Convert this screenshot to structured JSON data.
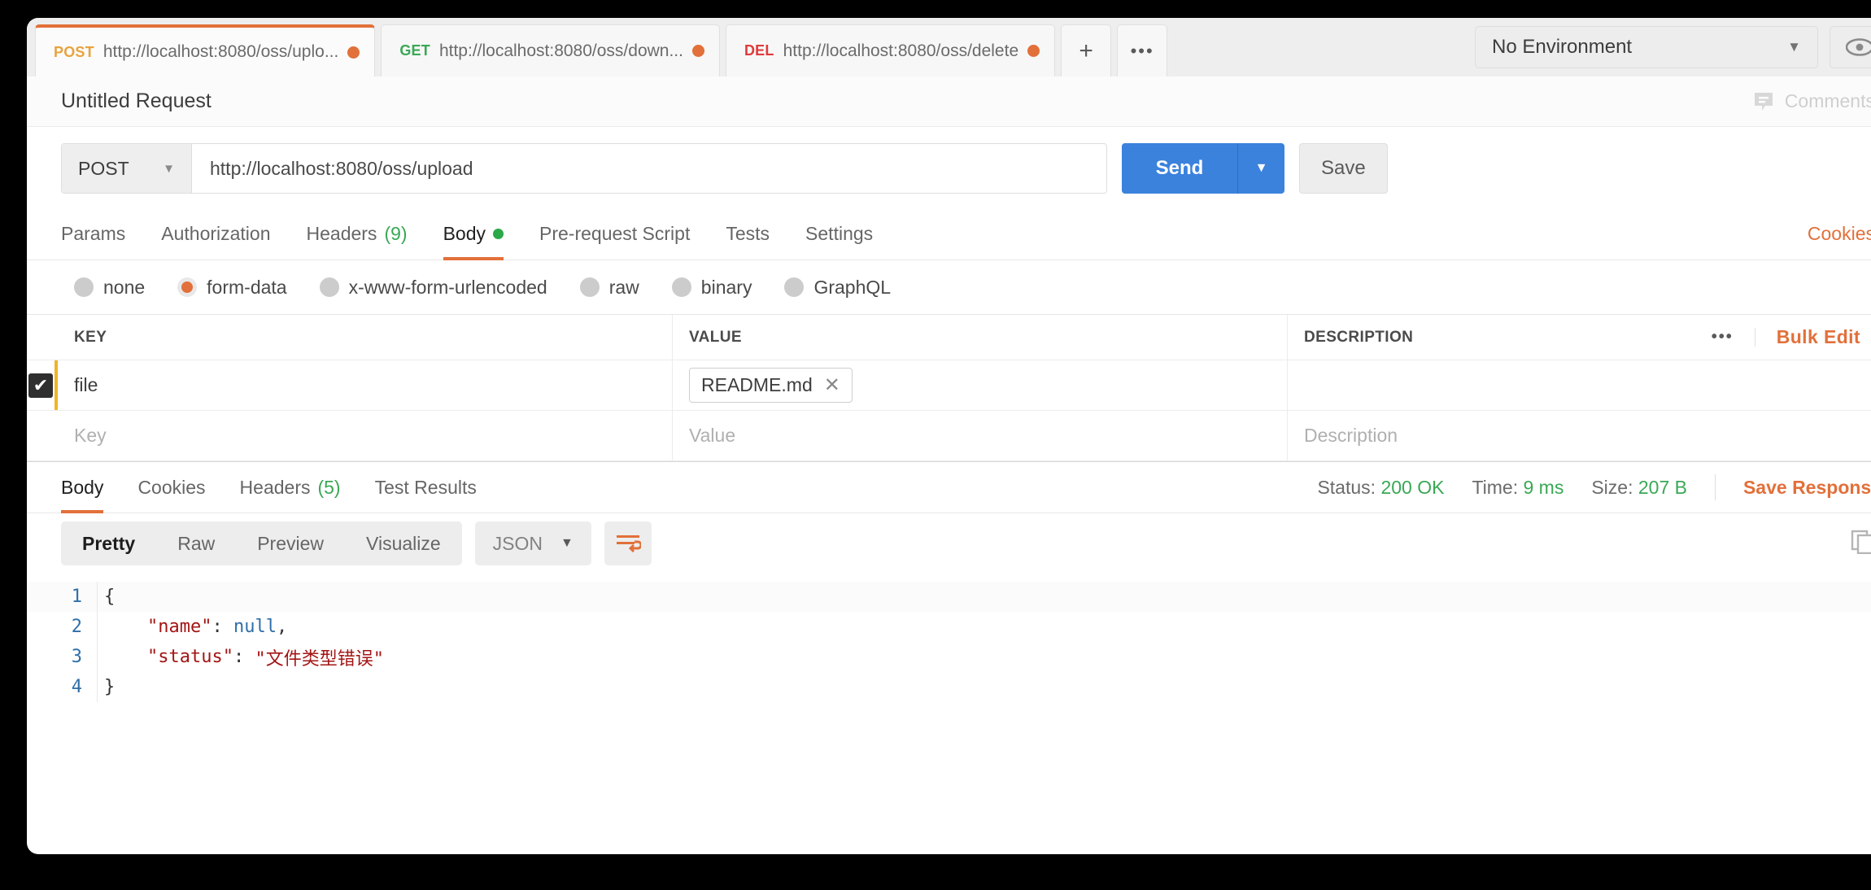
{
  "tabs": [
    {
      "verb": "POST",
      "verb_class": "verb-post",
      "url": "http://localhost:8080/oss/uplo...",
      "active": true
    },
    {
      "verb": "GET",
      "verb_class": "verb-get",
      "url": "http://localhost:8080/oss/down...",
      "active": false
    },
    {
      "verb": "DEL",
      "verb_class": "verb-del",
      "url": "http://localhost:8080/oss/delete",
      "active": false
    }
  ],
  "tabbar": {
    "new_tab_label": "+",
    "more_label": "•••"
  },
  "environment": {
    "selected": "No Environment",
    "caret": "▼"
  },
  "header": {
    "title": "Untitled Request",
    "comments_label": "Comments"
  },
  "request": {
    "method": "POST",
    "method_caret": "▼",
    "url": "http://localhost:8080/oss/upload",
    "send_label": "Send",
    "send_caret": "▼",
    "save_label": "Save"
  },
  "request_tabs": [
    {
      "label": "Params",
      "active": false
    },
    {
      "label": "Authorization",
      "active": false
    },
    {
      "label": "Headers",
      "count": "(9)",
      "active": false
    },
    {
      "label": "Body",
      "active": true,
      "dot": true
    },
    {
      "label": "Pre-request Script",
      "active": false
    },
    {
      "label": "Tests",
      "active": false
    },
    {
      "label": "Settings",
      "active": false
    }
  ],
  "cookies_link": "Cookies",
  "body_types": [
    {
      "label": "none",
      "selected": false
    },
    {
      "label": "form-data",
      "selected": true
    },
    {
      "label": "x-www-form-urlencoded",
      "selected": false
    },
    {
      "label": "raw",
      "selected": false
    },
    {
      "label": "binary",
      "selected": false
    },
    {
      "label": "GraphQL",
      "selected": false
    }
  ],
  "kv_table": {
    "headers": {
      "key": "KEY",
      "value": "VALUE",
      "description": "DESCRIPTION"
    },
    "tools": {
      "dots": "•••",
      "bulk_edit": "Bulk Edit"
    },
    "rows": [
      {
        "checked": true,
        "key": "file",
        "value_chip": "README.md",
        "chip_remove": "✕",
        "description": ""
      }
    ],
    "placeholder_row": {
      "key": "Key",
      "value": "Value",
      "description": "Description"
    }
  },
  "response_tabs": [
    {
      "label": "Body",
      "active": true
    },
    {
      "label": "Cookies",
      "active": false
    },
    {
      "label": "Headers",
      "count": "(5)",
      "active": false
    },
    {
      "label": "Test Results",
      "active": false
    }
  ],
  "response_meta": {
    "status_label": "Status:",
    "status_value": "200 OK",
    "time_label": "Time:",
    "time_value": "9 ms",
    "size_label": "Size:",
    "size_value": "207 B",
    "save_response": "Save Response"
  },
  "response_toolbar": {
    "views": [
      {
        "label": "Pretty",
        "active": true
      },
      {
        "label": "Raw",
        "active": false
      },
      {
        "label": "Preview",
        "active": false
      },
      {
        "label": "Visualize",
        "active": false
      }
    ],
    "format": "JSON",
    "format_caret": "▼"
  },
  "response_body": {
    "lines": [
      {
        "n": "1",
        "segments": [
          {
            "t": "{",
            "c": "tok-pun"
          }
        ]
      },
      {
        "n": "2",
        "segments": [
          {
            "t": "    ",
            "c": "tok-pun"
          },
          {
            "t": "\"name\"",
            "c": "tok-key"
          },
          {
            "t": ": ",
            "c": "tok-pun"
          },
          {
            "t": "null",
            "c": "tok-null"
          },
          {
            "t": ",",
            "c": "tok-pun"
          }
        ]
      },
      {
        "n": "3",
        "segments": [
          {
            "t": "    ",
            "c": "tok-pun"
          },
          {
            "t": "\"status\"",
            "c": "tok-key"
          },
          {
            "t": ": ",
            "c": "tok-pun"
          },
          {
            "t": "\"文件类型错误\"",
            "c": "tok-str"
          }
        ]
      },
      {
        "n": "4",
        "segments": [
          {
            "t": "}",
            "c": "tok-pun"
          }
        ]
      }
    ]
  },
  "colors": {
    "accent_orange": "#e2703a",
    "send_blue": "#3b82dd",
    "success_green": "#3aa856",
    "warning_yellow": "#f0b429"
  }
}
